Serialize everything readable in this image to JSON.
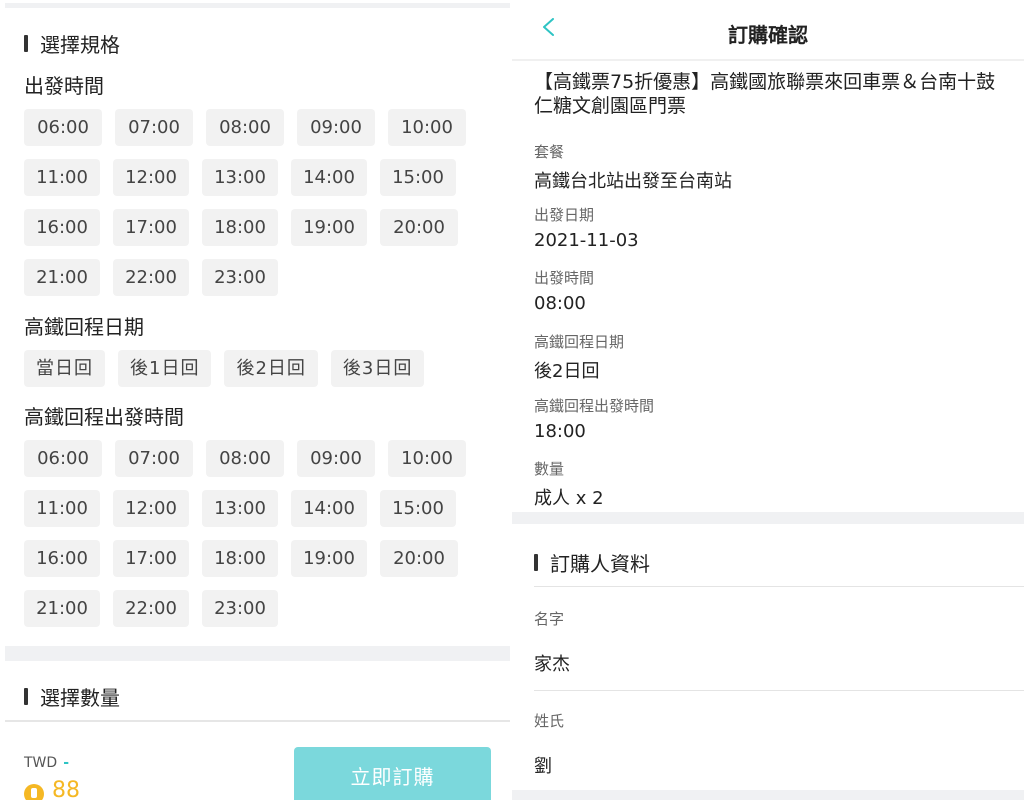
{
  "left": {
    "section_spec": "選擇規格",
    "departure_time_label": "出發時間",
    "departure_times": [
      "06:00",
      "07:00",
      "08:00",
      "09:00",
      "10:00",
      "11:00",
      "12:00",
      "13:00",
      "14:00",
      "15:00",
      "16:00",
      "17:00",
      "18:00",
      "19:00",
      "20:00",
      "21:00",
      "22:00",
      "23:00"
    ],
    "return_date_label": "高鐵回程日期",
    "return_dates": [
      "當日回",
      "後1日回",
      "後2日回",
      "後3日回"
    ],
    "return_time_label": "高鐵回程出發時間",
    "return_times": [
      "06:00",
      "07:00",
      "08:00",
      "09:00",
      "10:00",
      "11:00",
      "12:00",
      "13:00",
      "14:00",
      "15:00",
      "16:00",
      "17:00",
      "18:00",
      "19:00",
      "20:00",
      "21:00",
      "22:00",
      "23:00"
    ],
    "section_quantity": "選擇數量",
    "currency": "TWD",
    "price_placeholder": "-",
    "points": "88",
    "buy_button": "立即訂購"
  },
  "right": {
    "nav_title": "訂購確認",
    "product_title": "【高鐵票75折優惠】高鐵國旅聯票來回車票＆台南十鼓仁糖文創園區門票",
    "fields": [
      {
        "label": "套餐",
        "value": "高鐵台北站出發至台南站"
      },
      {
        "label": "出發日期",
        "value": "2021-11-03"
      },
      {
        "label": "出發時間",
        "value": "08:00"
      },
      {
        "label": "高鐵回程日期",
        "value": "後2日回"
      },
      {
        "label": "高鐵回程出發時間",
        "value": "18:00"
      },
      {
        "label": "數量",
        "value": "成人 x 2"
      }
    ],
    "buyer_section": "訂購人資料",
    "first_name_label": "名字",
    "first_name_value": "家杰",
    "last_name_label": "姓氏",
    "last_name_value": "劉"
  },
  "colors": {
    "accent": "#2ec4c4",
    "button_bg": "#7bd8dc",
    "coin": "#f5b824",
    "chip_bg": "#f2f2f2",
    "band_bg": "#f0f1f3"
  }
}
